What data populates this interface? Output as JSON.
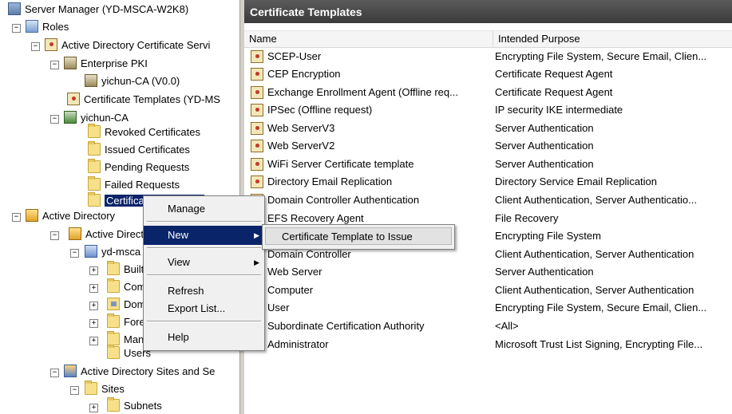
{
  "tree": {
    "server_manager": "Server Manager (YD-MSCA-W2K8)",
    "roles": "Roles",
    "ad_cert_services": "Active Directory Certificate Servi",
    "enterprise_pki": "Enterprise PKI",
    "yichun_ca_v0": "yichun-CA (V0.0)",
    "cert_templates_node": "Certificate Templates (YD-MS",
    "yichun_ca": "yichun-CA",
    "revoked": "Revoked Certificates",
    "issued": "Issued Certificates",
    "pending": "Pending Requests",
    "failed": "Failed Requests",
    "cert_templates_selected": "Certificate Templates",
    "ad_domain_services": "Active Directory",
    "ad_users_computers": "Active Direct",
    "yd_msca": "yd-msca",
    "builtin": "Built",
    "computers": "Com",
    "domain_controllers": "Dom",
    "foreign": "Fore",
    "managed": "Man",
    "users": "Users",
    "ad_sites": "Active Directory Sites and Se",
    "sites": "Sites",
    "subnets": "Subnets"
  },
  "panel": {
    "title": "Certificate Templates",
    "col_name": "Name",
    "col_purpose": "Intended Purpose"
  },
  "rows": [
    {
      "name": "SCEP-User",
      "purpose": "Encrypting File System, Secure Email, Clien..."
    },
    {
      "name": "CEP Encryption",
      "purpose": "Certificate Request Agent"
    },
    {
      "name": "Exchange Enrollment Agent (Offline req...",
      "purpose": "Certificate Request Agent"
    },
    {
      "name": "IPSec (Offline request)",
      "purpose": "IP security IKE intermediate"
    },
    {
      "name": "Web ServerV3",
      "purpose": "Server Authentication"
    },
    {
      "name": "Web ServerV2",
      "purpose": "Server Authentication"
    },
    {
      "name": "WiFi Server Certificate template",
      "purpose": "Server Authentication"
    },
    {
      "name": "Directory Email Replication",
      "purpose": "Directory Service Email Replication"
    },
    {
      "name": "Domain Controller Authentication",
      "purpose": "Client Authentication, Server Authenticatio..."
    },
    {
      "name": "EFS Recovery Agent",
      "purpose": "File Recovery"
    },
    {
      "name": "",
      "purpose": "Encrypting File System"
    },
    {
      "name": "Domain Controller",
      "purpose": "Client Authentication, Server Authentication"
    },
    {
      "name": "Web Server",
      "purpose": "Server Authentication"
    },
    {
      "name": "Computer",
      "purpose": "Client Authentication, Server Authentication"
    },
    {
      "name": "User",
      "purpose": "Encrypting File System, Secure Email, Clien..."
    },
    {
      "name": "Subordinate Certification Authority",
      "purpose": "<All>"
    },
    {
      "name": "Administrator",
      "purpose": "Microsoft Trust List Signing, Encrypting File..."
    }
  ],
  "context_menu": {
    "manage": "Manage",
    "new": "New",
    "view": "View",
    "refresh": "Refresh",
    "export_list": "Export List...",
    "help": "Help"
  },
  "submenu": {
    "cert_template_to_issue": "Certificate Template to Issue"
  },
  "icons": {
    "expand": "⊞",
    "collapse": "⊟",
    "submenu_arrow": "▶"
  },
  "colors": {
    "selection": "#0a246a",
    "title_bar": "#4a4a4a"
  }
}
